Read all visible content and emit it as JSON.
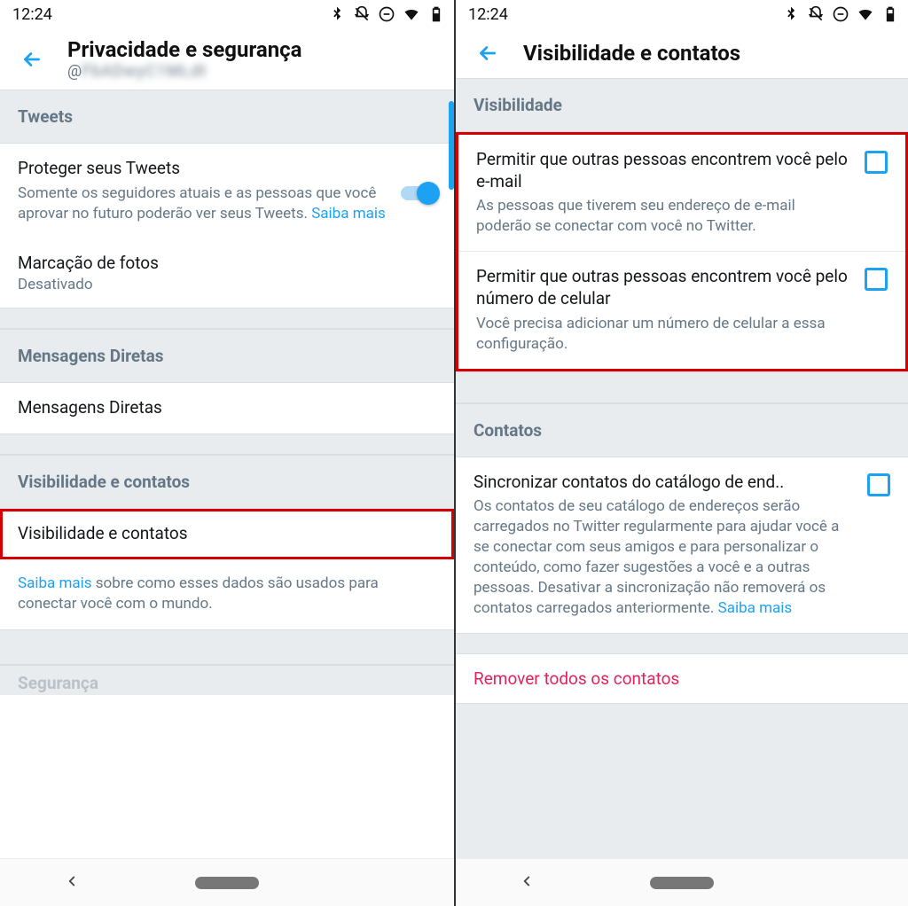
{
  "status": {
    "time": "12:24"
  },
  "left": {
    "title": "Privacidade e segurança",
    "handle_prefix": "@",
    "sections": {
      "tweets": "Tweets",
      "dm": "Mensagens Diretas",
      "vc": "Visibilidade e contatos",
      "security_peek": "Segurança"
    },
    "protect": {
      "label": "Proteger seus Tweets",
      "desc_a": "Somente os seguidores atuais e as pessoas que você aprovar no futuro poderão ver seus Tweets. ",
      "link": "Saiba mais"
    },
    "tagging": {
      "label": "Marcação de fotos",
      "status": "Desativado"
    },
    "dm_row": "Mensagens Diretas",
    "vc_row": "Visibilidade e contatos",
    "info_link": "Saiba mais",
    "info_rest": " sobre como esses dados são usados para conectar você com o mundo."
  },
  "right": {
    "title": "Visibilidade e contatos",
    "sections": {
      "vis": "Visibilidade",
      "contacts": "Contatos"
    },
    "find_email": {
      "label": "Permitir que outras pessoas encontrem você pelo e-mail",
      "desc": "As pessoas que tiverem seu endereço de e-mail poderão se conectar com você no Twitter."
    },
    "find_phone": {
      "label": "Permitir que outras pessoas encontrem você pelo número de celular",
      "desc": "Você precisa adicionar um número de celular a essa configuração."
    },
    "sync": {
      "label": "Sincronizar contatos do catálogo de end..",
      "desc_a": "Os contatos de seu catálogo de endereços serão carregados no Twitter regularmente para ajudar você a se conectar com seus amigos e para personalizar o conteúdo, como fazer sugestões a você e a outras pessoas. Desativar a sincronização não removerá os contatos carregados anteriormente. ",
      "link": "Saiba mais"
    },
    "remove_all": "Remover todos os contatos"
  }
}
